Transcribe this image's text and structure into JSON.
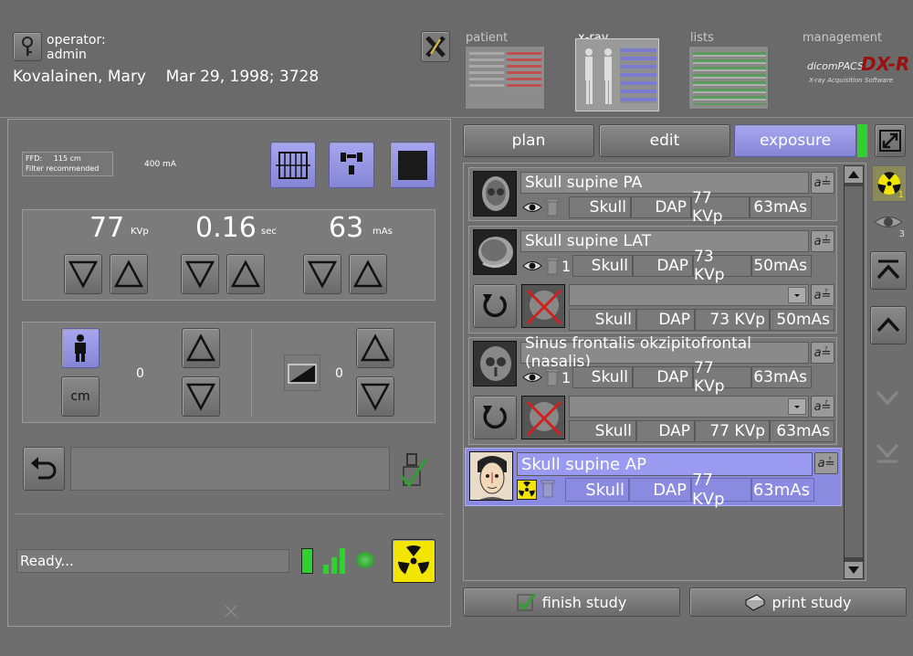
{
  "header": {
    "operator_label": "operator:",
    "operator_name": "admin",
    "patient_line": "Kovalainen, Mary    Mar 29, 1998; 3728",
    "tabs": [
      "patient",
      "x-ray",
      "lists",
      "management"
    ],
    "brand": "dicomPACS",
    "brand_mark": "DX-R",
    "brand_tagline": "X-ray Acquisition Software"
  },
  "left": {
    "ffd_line1": "FFD:     115 cm",
    "ffd_line2": "Filter recommended",
    "current": "400 mA",
    "kvp": {
      "value": "77",
      "unit": "KVp"
    },
    "sec": {
      "value": "0.16",
      "unit": "sec"
    },
    "mas": {
      "value": "63",
      "unit": "mAs"
    },
    "patient_size_value": "0",
    "density_value": "0",
    "cm_label": "cm",
    "status": "Ready..."
  },
  "modes": {
    "plan": "plan",
    "edit": "edit",
    "exposure": "exposure"
  },
  "exams": [
    {
      "title": "Skull supine PA",
      "count": "",
      "region": "Skull",
      "dose": "DAP",
      "kvp": "77 KVp",
      "mas": "63mAs"
    },
    {
      "title": "Skull supine LAT",
      "count": "1",
      "region": "Skull",
      "dose": "DAP",
      "kvp": "73 KVp",
      "mas": "50mAs",
      "image": {
        "region": "Skull",
        "dose": "DAP",
        "kvp": "73 KVp",
        "mas": "50mAs"
      }
    },
    {
      "title": "Sinus frontalis okzipitofrontal (nasalis)",
      "count": "1",
      "region": "Skull",
      "dose": "DAP",
      "kvp": "77 KVp",
      "mas": "63mAs",
      "image": {
        "region": "Skull",
        "dose": "DAP",
        "kvp": "77 KVp",
        "mas": "63mAs"
      }
    },
    {
      "title": "Skull supine AP",
      "count": "",
      "region": "Skull",
      "dose": "DAP",
      "kvp": "77 KVp",
      "mas": "63mAs"
    }
  ],
  "side_counts": {
    "radiation": "1",
    "viewed": "3"
  },
  "footer": {
    "finish": "finish study",
    "print": "print study"
  },
  "colors": {
    "accent": "#8a8ae0",
    "ready_green": "#2fd02f",
    "radiation_yellow": "#f2e600"
  }
}
